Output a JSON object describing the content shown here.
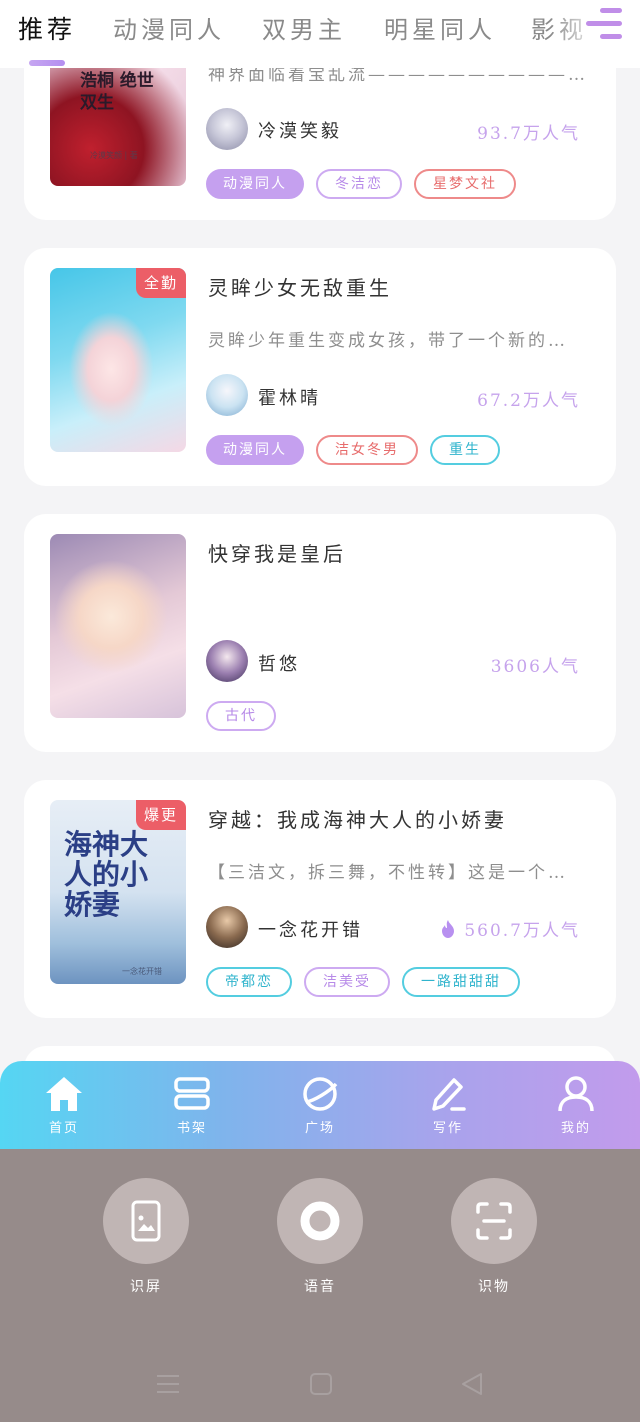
{
  "tabs": [
    "推荐",
    "动漫同人",
    "双男主",
    "明星同人",
    "影视"
  ],
  "books": [
    {
      "title": "",
      "desc": "神界面临着宝乱流————————————…",
      "cover_title": "浩桐 绝世双生",
      "cover_author": "冷漠笑颜 | 著",
      "author": "冷漠笑毅",
      "popularity": "93.7万人气",
      "tags": [
        "动漫同人",
        "冬洁恋",
        "星梦文社"
      ]
    },
    {
      "title": "灵眸少女无敌重生",
      "desc": "灵眸少年重生变成女孩，带了一个新的…",
      "badge": "全勤",
      "author": "霍林晴",
      "popularity": "67.2万人气",
      "tags": [
        "动漫同人",
        "洁女冬男",
        "重生"
      ]
    },
    {
      "title": "快穿我是皇后",
      "author": "哲悠",
      "popularity": "3606人气",
      "tags": [
        "古代"
      ]
    },
    {
      "title": "穿越：我成海神大人的小娇妻",
      "desc": "【三洁文，拆三舞，不性转】这是一个…",
      "badge": "爆更",
      "cover_title": "海神大人的小娇妻",
      "cover_author": "一念花开错",
      "author": "一念花开错",
      "popularity": "560.7万人气",
      "tags": [
        "帝都恋",
        "洁美受",
        "一路甜甜甜"
      ]
    }
  ],
  "bottom_nav": [
    "首页",
    "书架",
    "广场",
    "写作",
    "我的"
  ],
  "overlay_actions": [
    "识屏",
    "语音",
    "识物"
  ],
  "colors": {
    "accent": "#c29bec",
    "nav_start": "#55d6f3",
    "panel": "#968b8a"
  }
}
